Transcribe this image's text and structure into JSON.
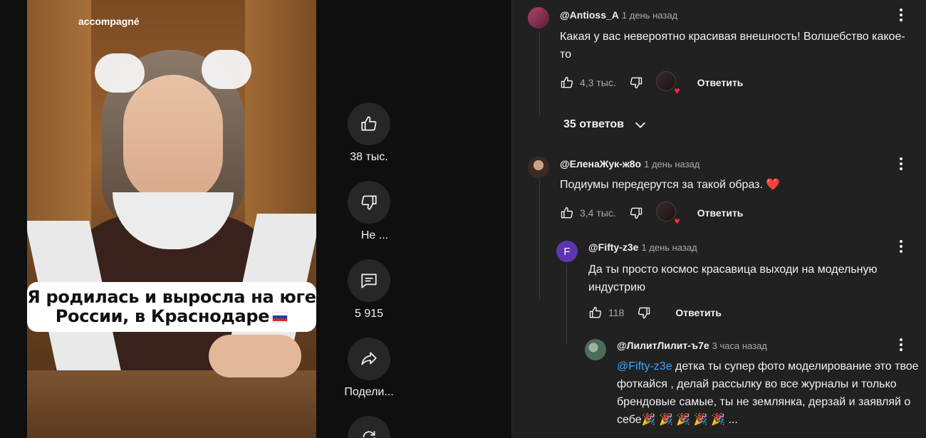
{
  "video": {
    "source_tag": "accompagné",
    "caption_line1": "Я родилась и выросла на юге",
    "caption_line2": "России, в Краснодаре"
  },
  "actions": {
    "like_count": "38 тыс.",
    "dislike_label": "Не ...",
    "comments_count": "5 915",
    "share_label": "Подели..."
  },
  "comments": [
    {
      "author": "@Antioss_A",
      "time": "1 день назад",
      "text": "Какая у вас невероятно красивая внешность! Волшебство какое-то",
      "likes": "4,3 тыс.",
      "reply_label": "Ответить",
      "replies_label": "35 ответов"
    },
    {
      "author": "@ЕленаЖук-ж8о",
      "time": "1 день назад",
      "text": "Подиумы передерутся за такой образ. ❤️",
      "likes": "3,4 тыс.",
      "reply_label": "Ответить"
    },
    {
      "author": "@Fifty-z3e",
      "avatar_letter": "F",
      "time": "1 день назад",
      "text": "Да ты просто космос красавица выходи на модельную индустрию",
      "likes": "118",
      "reply_label": "Ответить"
    },
    {
      "author": "@ЛилитЛилит-ъ7е",
      "time": "3 часа назад",
      "mention": "@Fifty-z3e",
      "text": "детка ты супер фото моделирование это твое фоткайся , делай рассылку во все журналы и только брендовые самые, ты не землянка, дерзай и заявляй о себе🎉 🎉 🎉 🎉 🎉 ..."
    }
  ],
  "colors": {
    "background": "#0f0f0f",
    "panel": "#212121",
    "button_bg": "#272727",
    "mention": "#3ea6ff",
    "heart": "#ff2a3a"
  }
}
